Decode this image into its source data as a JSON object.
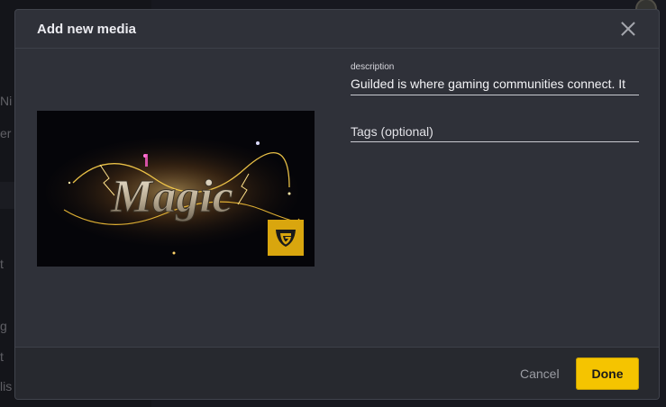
{
  "background": {
    "fragments": [
      "Ni",
      "er",
      "t",
      "g",
      "t",
      "lis"
    ]
  },
  "modal": {
    "title": "Add new media",
    "description_label": "description",
    "description_value": "Guilded is where gaming communities connect. It",
    "tags_placeholder": "Tags (optional)",
    "preview_text": "Magic",
    "cancel_label": "Cancel",
    "done_label": "Done"
  },
  "colors": {
    "accent": "#f5c400",
    "modal_bg": "#2f3139",
    "footer_bg": "#27292f"
  },
  "icons": {
    "close": "close-icon",
    "brand": "guilded-logo-icon"
  }
}
